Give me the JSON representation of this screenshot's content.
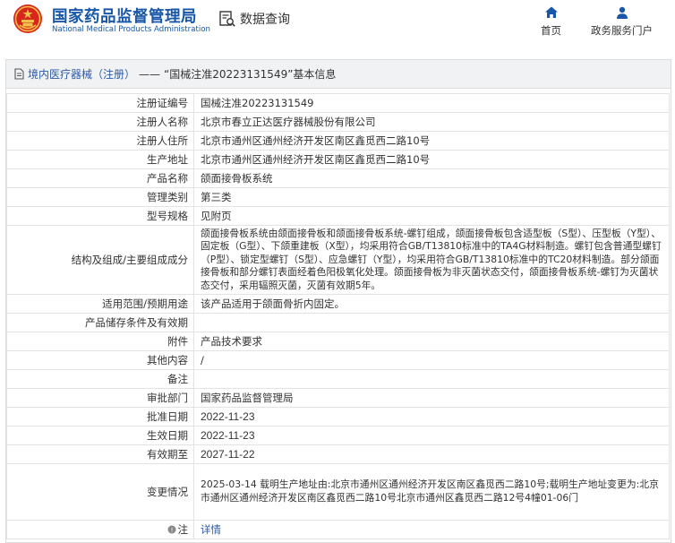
{
  "header": {
    "logo_cn": "国家药品监督管理局",
    "logo_en": "National Medical Products Administration",
    "search_label": "数据查询",
    "nav": [
      {
        "label": "首页",
        "icon": "home-icon"
      },
      {
        "label": "政务服务门户",
        "icon": "user-icon"
      }
    ]
  },
  "breadcrumb": {
    "category": "境内医疗器械（注册）",
    "separator": "——",
    "title": "“国械注准20223131549”基本信息"
  },
  "fields": [
    {
      "label": "注册证编号",
      "value": "国械注准20223131549"
    },
    {
      "label": "注册人名称",
      "value": "北京市春立正达医疗器械股份有限公司"
    },
    {
      "label": "注册人住所",
      "value": "北京市通州区通州经济开发区南区鑫觅西二路10号"
    },
    {
      "label": "生产地址",
      "value": "北京市通州区通州经济开发区南区鑫觅西二路10号"
    },
    {
      "label": "产品名称",
      "value": "颌面接骨板系统"
    },
    {
      "label": "管理类别",
      "value": "第三类"
    },
    {
      "label": "型号规格",
      "value": "见附页"
    },
    {
      "label": "结构及组成/主要组成成分",
      "value": "颌面接骨板系统由颌面接骨板和颌面接骨板系统-螺钉组成，颌面接骨板包含适型板（S型）、压型板（Y型）、固定板（G型）、下颌重建板（X型），均采用符合GB/T13810标准中的TA4G材料制造。螺钉包含普通型螺钉（P型）、锁定型螺钉（S型）、应急螺钉（Y型），均采用符合GB/T13810标准中的TC20材料制造。部分颌面接骨板和部分螺钉表面经着色阳极氧化处理。颌面接骨板为非灭菌状态交付，颌面接骨板系统-螺钉为灭菌状态交付，采用辐照灭菌，灭菌有效期5年。"
    },
    {
      "label": "适用范围/预期用途",
      "value": "该产品适用于颌面骨折内固定。"
    },
    {
      "label": "产品储存条件及有效期",
      "value": ""
    },
    {
      "label": "附件",
      "value": "产品技术要求"
    },
    {
      "label": "其他内容",
      "value": "/"
    },
    {
      "label": "备注",
      "value": ""
    },
    {
      "label": "审批部门",
      "value": "国家药品监督管理局"
    },
    {
      "label": "批准日期",
      "value": "2022-11-23"
    },
    {
      "label": "生效日期",
      "value": "2022-11-23"
    },
    {
      "label": "有效期至",
      "value": "2027-11-22"
    },
    {
      "label": "变更情况",
      "value": "2025-03-14 载明生产地址由:北京市通州区通州经济开发区南区鑫觅西二路10号;载明生产地址变更为:北京市通州区通州经济开发区南区鑫觅西二路10号北京市通州区鑫觅西二路12号4幢01-06门"
    },
    {
      "label": "注",
      "value": "详情",
      "icon": "note-icon"
    }
  ],
  "colors": {
    "brand_blue": "#1857a8",
    "link_blue": "#2a5aa6",
    "emblem_red": "#d7261b",
    "emblem_gold": "#f2c14a"
  }
}
